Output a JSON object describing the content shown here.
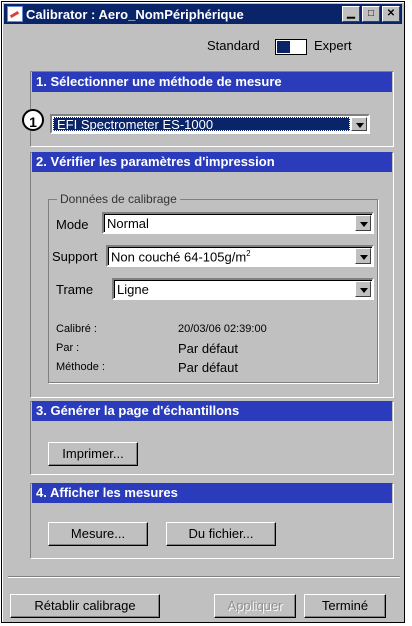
{
  "window": {
    "title": "Calibrator : Aero_NomPériphérique",
    "minimize": "▁",
    "maximize": "□",
    "close": "✕"
  },
  "mode_toggle": {
    "left_label": "Standard",
    "right_label": "Expert",
    "state": "Standard"
  },
  "callout": "1",
  "section1": {
    "header": "1. Sélectionner une méthode de mesure",
    "method_value": "EFI Spectrometer ES-1000"
  },
  "section2": {
    "header": "2. Vérifier les paramètres d'impression",
    "group_title": "Données de calibrage",
    "mode_label": "Mode",
    "mode_value": "Normal",
    "support_label": "Support",
    "support_value": "Non couché 64-105g/m",
    "support_sup": "2",
    "trame_label": "Trame",
    "trame_value": "Ligne",
    "calibre_label": "Calibré :",
    "calibre_value": "20/03/06  02:39:00",
    "par_label": "Par :",
    "par_value": "Par défaut",
    "methode_label": "Méthode :",
    "methode_value": "Par défaut"
  },
  "section3": {
    "header": "3. Générer la page d'échantillons",
    "print_button": "Imprimer..."
  },
  "section4": {
    "header": "4. Afficher les mesures",
    "measure_button": "Mesure...",
    "file_button": "Du fichier..."
  },
  "footer": {
    "reset_button": "Rétablir calibrage",
    "apply_button": "Appliquer",
    "done_button": "Terminé"
  },
  "colors": {
    "title_bar": "#0a246a",
    "section_header": "#2a3cbc",
    "window_bg": "#c0c0c0"
  }
}
